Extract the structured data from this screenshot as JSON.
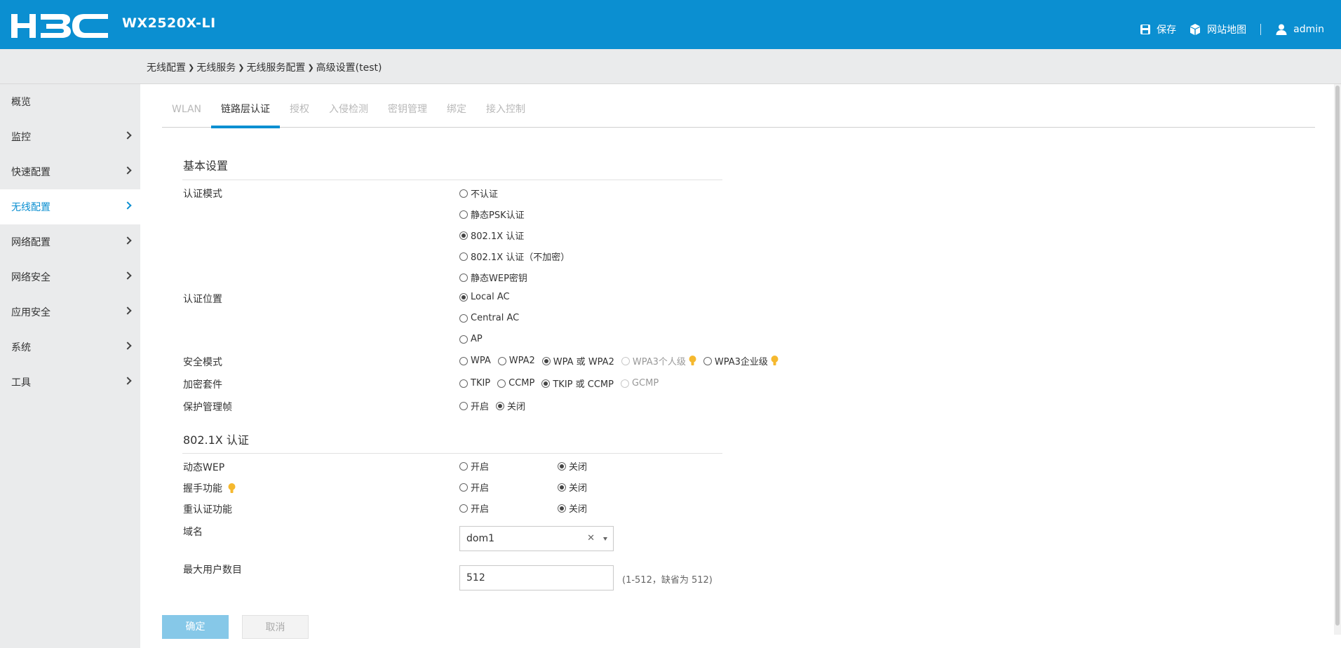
{
  "header": {
    "model": "WX2520X-LI",
    "save_label": "保存",
    "sitemap_label": "网站地图",
    "user_label": "admin"
  },
  "breadcrumb": [
    "无线配置",
    "无线服务",
    "无线服务配置",
    "高级设置(test)"
  ],
  "sidebar": {
    "items": [
      {
        "label": "概览"
      },
      {
        "label": "监控"
      },
      {
        "label": "快速配置"
      },
      {
        "label": "无线配置"
      },
      {
        "label": "网络配置"
      },
      {
        "label": "网络安全"
      },
      {
        "label": "应用安全"
      },
      {
        "label": "系统"
      },
      {
        "label": "工具"
      }
    ],
    "active_index": 3
  },
  "tabs": [
    {
      "label": "WLAN"
    },
    {
      "label": "链路层认证"
    },
    {
      "label": "授权"
    },
    {
      "label": "入侵检测"
    },
    {
      "label": "密钥管理"
    },
    {
      "label": "绑定"
    },
    {
      "label": "接入控制"
    }
  ],
  "basic": {
    "title": "基本设置",
    "auth_mode": {
      "label": "认证模式",
      "options": [
        "不认证",
        "静态PSK认证",
        "802.1X 认证",
        "802.1X 认证（不加密）",
        "静态WEP密钥"
      ],
      "selected": "802.1X 认证"
    },
    "auth_location": {
      "label": "认证位置",
      "options": [
        "Local AC",
        "Central AC",
        "AP"
      ],
      "selected": "Local AC"
    },
    "security_mode": {
      "label": "安全模式",
      "options": [
        "WPA",
        "WPA2",
        "WPA 或 WPA2",
        "WPA3个人级",
        "WPA3企业级"
      ],
      "selected": "WPA 或 WPA2"
    },
    "cipher_suite": {
      "label": "加密套件",
      "options": [
        "TKIP",
        "CCMP",
        "TKIP 或 CCMP",
        "GCMP"
      ],
      "selected": "TKIP 或 CCMP"
    },
    "pmf": {
      "label": "保护管理帧",
      "options": [
        "开启",
        "关闭"
      ],
      "selected": "关闭"
    }
  },
  "dot1x": {
    "title": "802.1X 认证",
    "dynamic_wep": {
      "label": "动态WEP",
      "on": "开启",
      "off": "关闭",
      "selected": "关闭"
    },
    "handshake": {
      "label": "握手功能",
      "on": "开启",
      "off": "关闭",
      "selected": "关闭"
    },
    "reauth": {
      "label": "重认证功能",
      "on": "开启",
      "off": "关闭",
      "selected": "关闭"
    },
    "domain": {
      "label": "域名",
      "value": "dom1"
    },
    "max_users": {
      "label": "最大用户数目",
      "value": "512",
      "hint": "(1-512，缺省为 512)"
    }
  },
  "actions": {
    "ok": "确定",
    "cancel": "取消"
  },
  "colors": {
    "brand": "#0b8fd1",
    "sidebar_bg": "#eaebec",
    "tip_bulb": "#f5b82e"
  }
}
